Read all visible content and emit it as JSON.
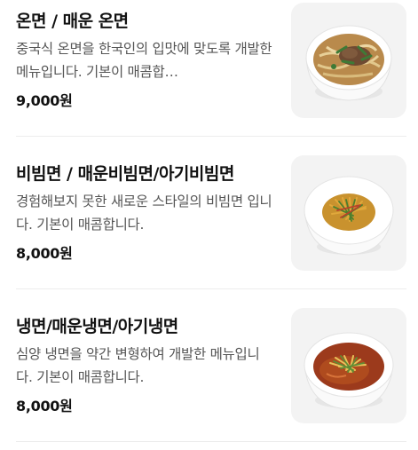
{
  "menu": {
    "items": [
      {
        "title": "온면 / 매운 온면",
        "description": "중국식 온면을 한국인의 입맛에 맞도록 개발한 메뉴입니다. 기본이 매콤합…",
        "price": "9,000원",
        "image_icon": "warm-noodle-bowl-icon"
      },
      {
        "title": "비빔면 / 매운비빔면/아기비빔면",
        "description": "경험해보지 못한 새로운 스타일의 비빔면 입니다. 기본이 매콤합니다.",
        "price": "8,000원",
        "image_icon": "bibim-noodle-bowl-icon"
      },
      {
        "title": "냉면/매운냉면/아기냉면",
        "description": "심양 냉면을 약간 변형하여 개발한 메뉴입니다. 기본이 매콤합니다.",
        "price": "8,000원",
        "image_icon": "cold-noodle-bowl-icon"
      }
    ]
  }
}
